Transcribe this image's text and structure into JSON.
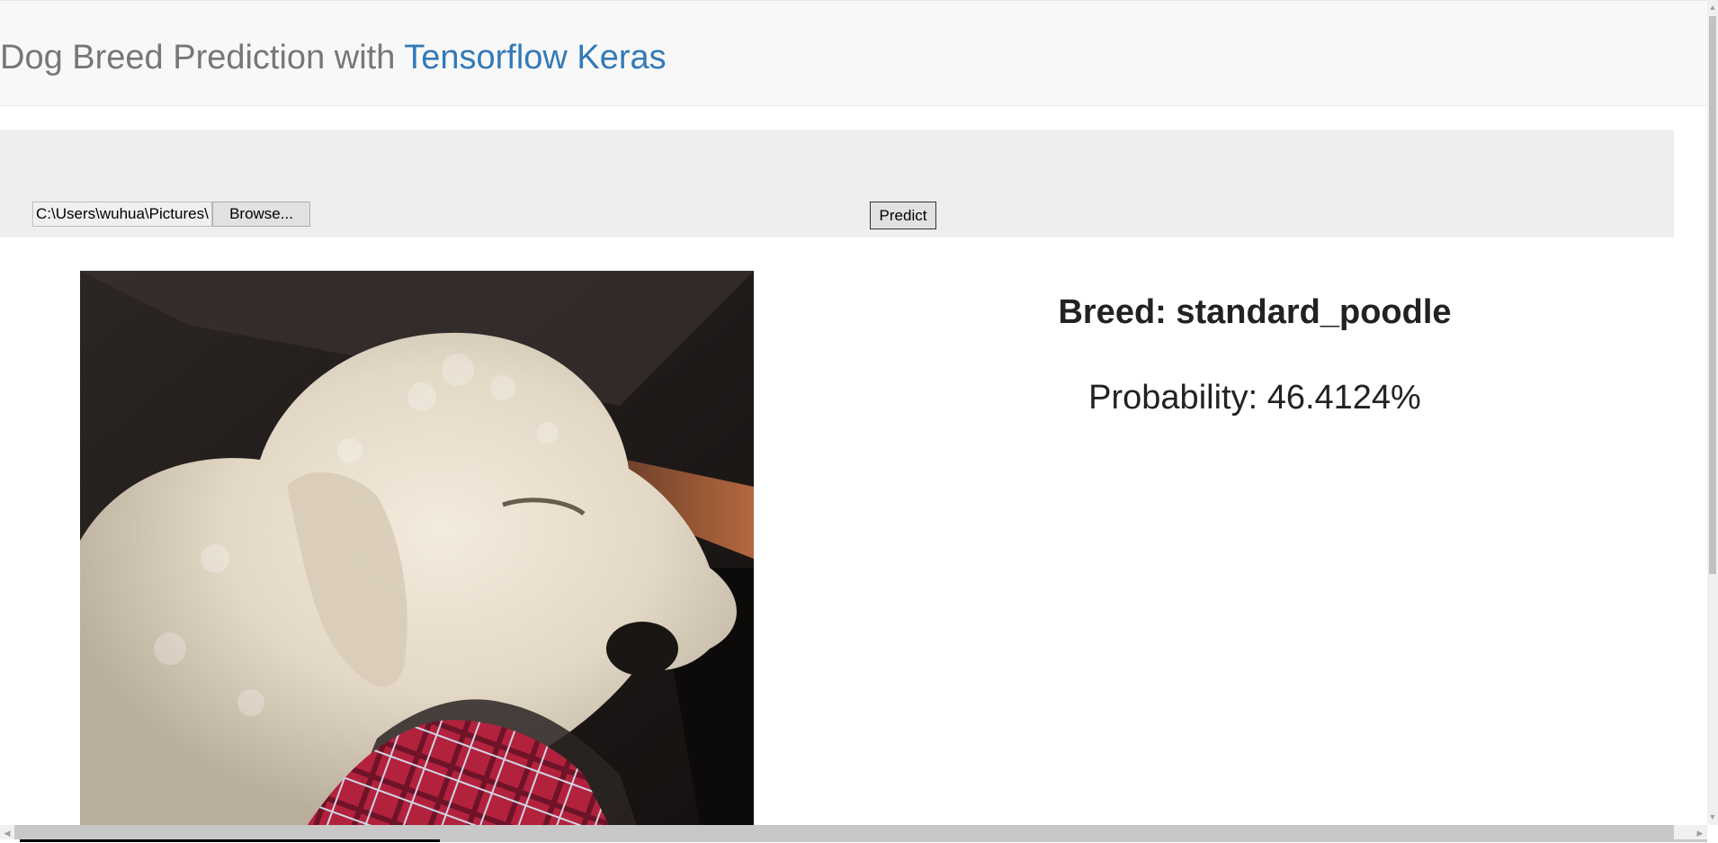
{
  "header": {
    "title_prefix": "Dog Breed Prediction with ",
    "title_link": "Tensorflow Keras"
  },
  "upload": {
    "file_path_value": "C:\\Users\\wuhua\\Pictures\\",
    "browse_label": "Browse...",
    "predict_label": "Predict"
  },
  "result": {
    "breed_text": "Breed: standard_poodle",
    "probability_text": "Probability: 46.4124%"
  },
  "scrollbars": {
    "up_arrow": "▲",
    "down_arrow": "▼",
    "left_arrow": "◀",
    "right_arrow": "▶"
  },
  "colors": {
    "link": "#337ab7",
    "brand_text": "#777777",
    "navbar_bg": "#f8f8f8",
    "jumbotron_bg": "#eeeeee"
  },
  "icons": {
    "uploaded_image": "dog-photo-image"
  }
}
